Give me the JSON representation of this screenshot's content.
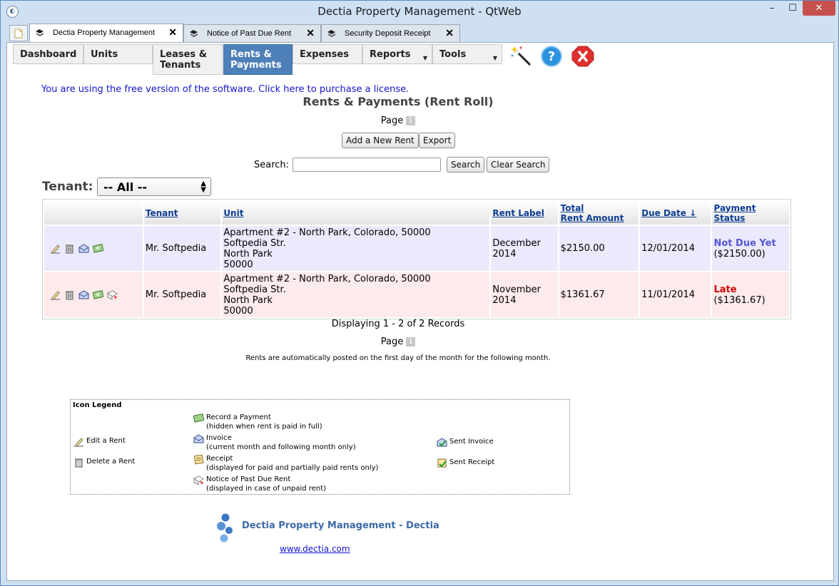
{
  "window": {
    "title": "Dectia Property Management - QtWeb",
    "min": "–",
    "max": "☐",
    "close": "✕"
  },
  "browser_tabs": [
    {
      "label": "Dectia Property Management"
    },
    {
      "label": "Notice of Past Due Rent"
    },
    {
      "label": "Security Deposit Receipt"
    }
  ],
  "nav": {
    "dashboard": "Dashboard",
    "units": "Units",
    "leases_line1": "Leases &",
    "leases_line2": "Tenants",
    "rents_line1": "Rents &",
    "rents_line2": "Payments",
    "expenses": "Expenses",
    "reports": "Reports",
    "tools": "Tools"
  },
  "license_notice": "You are using the free version of the software. Click here to purchase a license.",
  "page_title": "Rents & Payments (Rent Roll)",
  "pager": {
    "label": "Page",
    "page": "1"
  },
  "buttons": {
    "add_rent": "Add a New Rent",
    "export": "Export",
    "search": "Search",
    "clear_search": "Clear Search"
  },
  "search": {
    "label": "Search:",
    "value": ""
  },
  "tenant_filter": {
    "label": "Tenant:",
    "selected": "-- All --"
  },
  "table": {
    "headers": {
      "tenant": "Tenant",
      "unit": "Unit",
      "rent_label": "Rent Label",
      "total_line1": "Total",
      "total_line2": "Rent Amount",
      "due_date": "Due Date ↓",
      "status_line1": "Payment",
      "status_line2": "Status"
    },
    "rows": [
      {
        "tenant": "Mr. Softpedia",
        "unit_line1": "Apartment #2 - North Park, Colorado, 50000",
        "unit_line2": "Softpedia Str.",
        "unit_line3": "North Park",
        "unit_line4": "50000",
        "label_line1": "December",
        "label_line2": "2014",
        "amount": "$2150.00",
        "due": "12/01/2014",
        "status": "Not Due Yet",
        "status_amount": "($2150.00)"
      },
      {
        "tenant": "Mr. Softpedia",
        "unit_line1": "Apartment #2 - North Park, Colorado, 50000",
        "unit_line2": "Softpedia Str.",
        "unit_line3": "North Park",
        "unit_line4": "50000",
        "label_line1": "November",
        "label_line2": "2014",
        "amount": "$1361.67",
        "due": "11/01/2014",
        "status": "Late",
        "status_amount": "($1361.67)"
      }
    ]
  },
  "records_info": "Displaying 1 - 2 of 2 Records",
  "auto_post_note": "Rents are automatically posted on the first day of the month for the following month.",
  "legend": {
    "title": "Icon Legend",
    "edit": "Edit a Rent",
    "delete": "Delete a Rent",
    "record_l1": "Record a Payment",
    "record_l2": "(hidden when rent is paid in full)",
    "invoice_l1": "Invoice",
    "invoice_l2": "(current month and following month only)",
    "receipt_l1": "Receipt",
    "receipt_l2": "(displayed for paid and partially paid rents only)",
    "notice_l1": "Notice of Past Due Rent",
    "notice_l2": "(displayed in case of unpaid rent)",
    "sent_invoice": "Sent Invoice",
    "sent_receipt": "Sent Receipt"
  },
  "footer": {
    "brand": "Dectia Property Management - Dectia",
    "link": "www.dectia.com"
  },
  "colors": {
    "accent": "#4d80b8",
    "link": "#1515cc",
    "late": "#d40000",
    "not_due": "#5757d6"
  }
}
